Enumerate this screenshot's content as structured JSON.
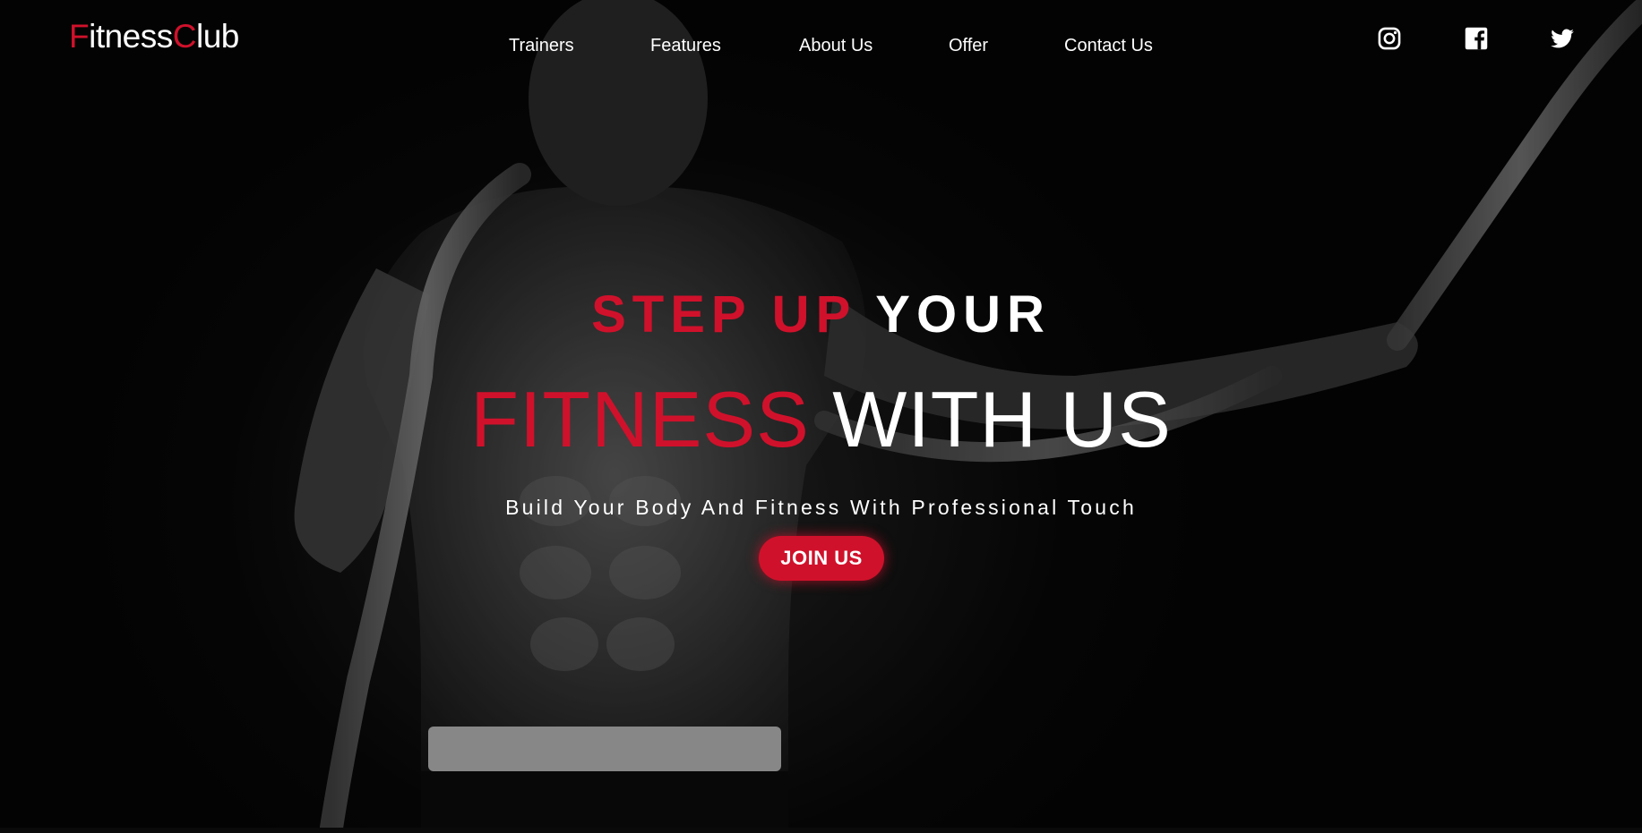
{
  "brand": {
    "logo_first_initial": "F",
    "logo_first_rest": "itness",
    "logo_second_initial": "C",
    "logo_second_rest": "lub"
  },
  "nav": {
    "items": [
      {
        "label": "Trainers"
      },
      {
        "label": "Features"
      },
      {
        "label": "About Us"
      },
      {
        "label": "Offer"
      },
      {
        "label": "Contact Us"
      }
    ]
  },
  "social": {
    "icons": [
      "instagram-icon",
      "facebook-icon",
      "twitter-icon"
    ]
  },
  "hero": {
    "line1_accent": "STEP UP",
    "line1_rest": "YOUR",
    "line2_accent": "FITNESS",
    "line2_rest": "WITH US",
    "tagline": "Build Your Body And Fitness With Professional Touch",
    "cta_label": "JOIN US"
  },
  "colors": {
    "accent": "#d0112b",
    "background": "#060606",
    "text": "#ffffff"
  }
}
